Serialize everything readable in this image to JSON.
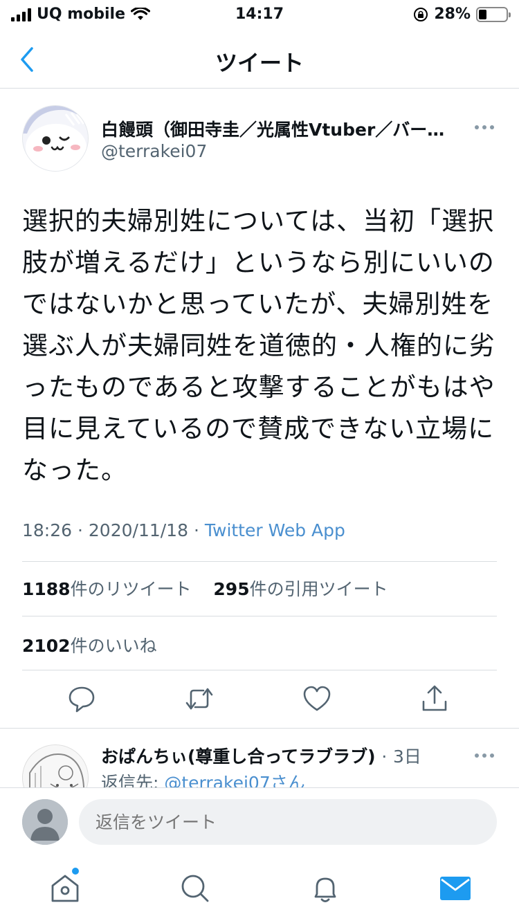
{
  "status_bar": {
    "carrier": "UQ mobile",
    "time": "14:17",
    "battery_percent": "28%",
    "battery_level": 0.28
  },
  "nav": {
    "title": "ツイート"
  },
  "tweet": {
    "author_name": "白饅頭（御田寺圭／光属性Vtuber／バー…",
    "author_handle": "@terrakei07",
    "text": "選択的夫婦別姓については、当初「選択肢が増えるだけ」というなら別にいいのではないかと思っていたが、夫婦別姓を選ぶ人が夫婦同姓を道徳的・人権的に劣ったものであると攻撃することがもはや目に見えているので賛成できない立場になった。",
    "time": "18:26",
    "date": "2020/11/18",
    "separator": "·",
    "source_app": "Twitter Web App",
    "retweets_count": "1188",
    "retweets_label": "件のリツイート",
    "quotes_count": "295",
    "quotes_label": "件の引用ツイート",
    "likes_count": "2102",
    "likes_label": "件のいいね"
  },
  "reply": {
    "author_name": "おぱんちぃ(尊重し合ってラブラブ)",
    "time_ago": "3日",
    "reply_to_label": "返信先: ",
    "reply_to_handle": "@terrakei07さん"
  },
  "composer": {
    "placeholder": "返信をツイート"
  },
  "colors": {
    "accent": "#1d9bf0",
    "link": "#4a8fcf",
    "secondary_text": "#536471",
    "divider": "#d9dde1"
  },
  "icons": {
    "back": "chevron-left-icon",
    "reply": "comment-icon",
    "retweet": "retweet-icon",
    "like": "heart-icon",
    "share": "share-icon",
    "home": "home-icon",
    "search": "search-icon",
    "notifications": "bell-icon",
    "messages": "envelope-icon"
  }
}
